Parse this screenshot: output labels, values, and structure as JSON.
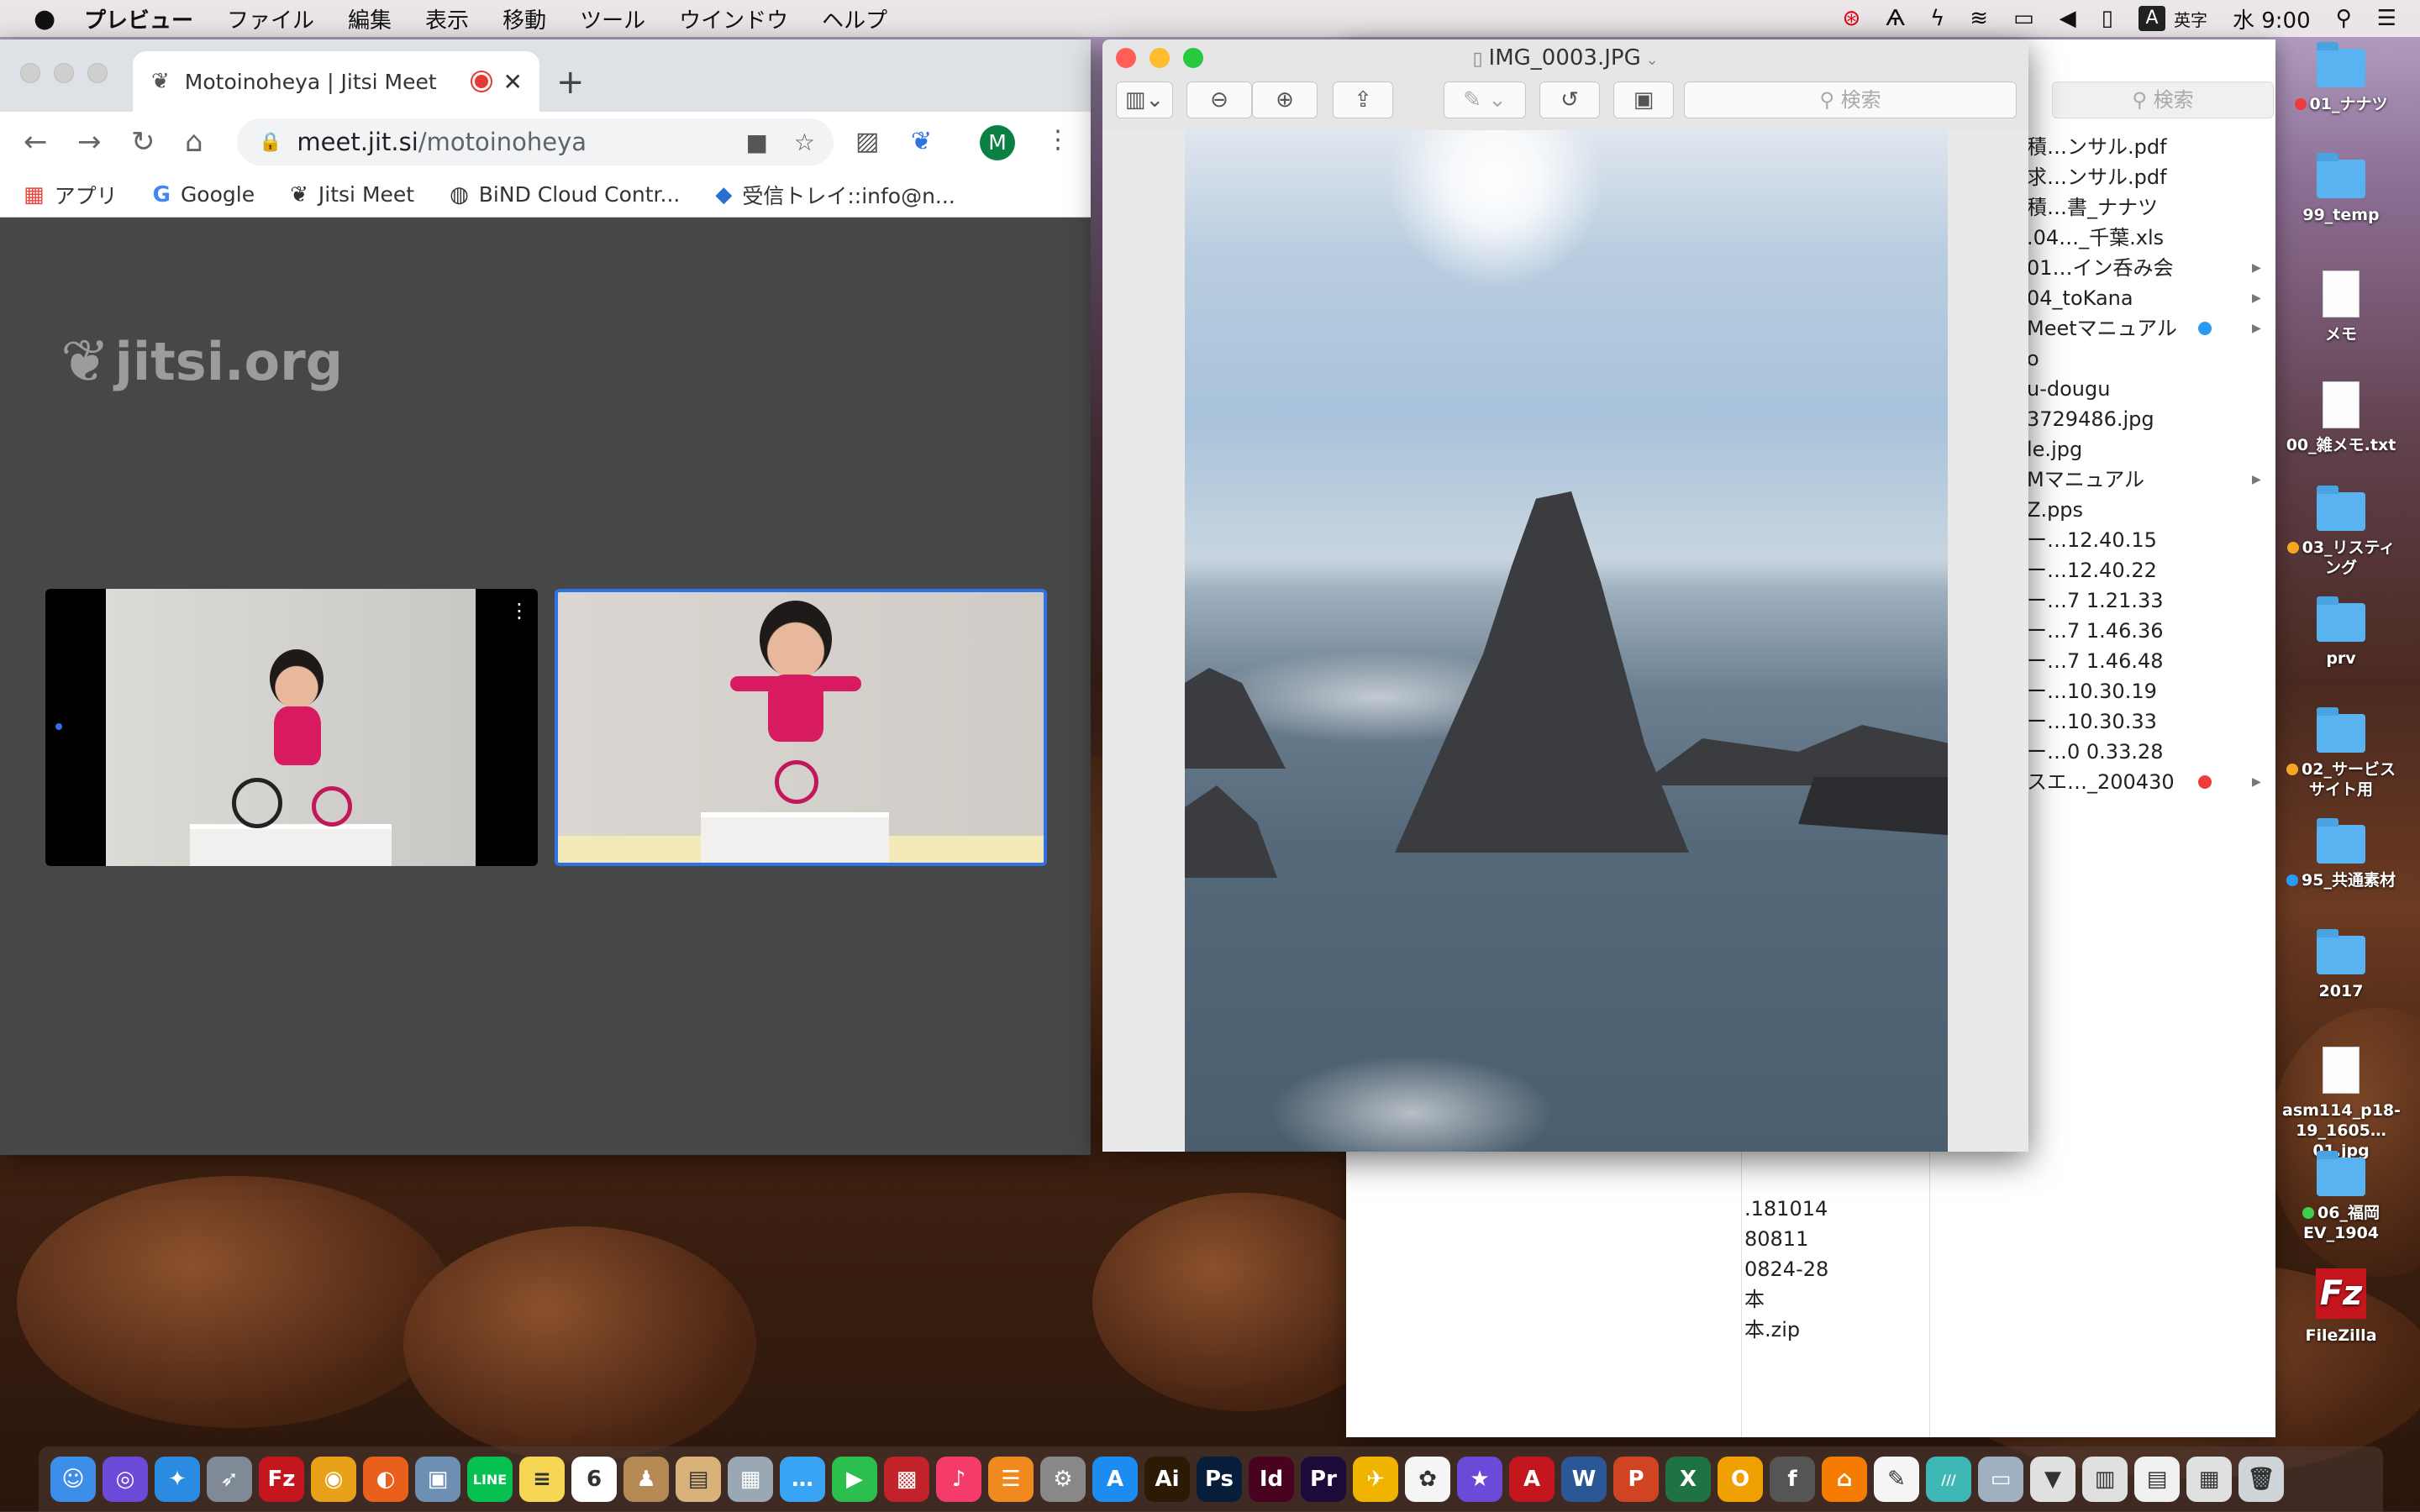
{
  "menubar": {
    "app": "プレビュー",
    "items": [
      "ファイル",
      "編集",
      "表示",
      "移動",
      "ツール",
      "ウインドウ",
      "ヘルプ"
    ],
    "ime": "A",
    "ime_label": "英字",
    "clock": "水 9:00"
  },
  "chrome": {
    "tab_title": "Motoinoheya | Jitsi Meet",
    "tab_close": "✕",
    "new_tab": "+",
    "url_host": "meet.jit.si",
    "url_path": "/motoinoheya",
    "profile_initial": "M",
    "bookmarks": [
      "アプリ",
      "Google",
      "Jitsi Meet",
      "BiND Cloud Contr...",
      "受信トレイ::info@n..."
    ],
    "bookmarks_more": "»",
    "jitsi_logo": "jitsi.org"
  },
  "preview": {
    "title": "IMG_0003.JPG",
    "search_placeholder": "検索"
  },
  "finder": {
    "search_placeholder": "検索",
    "col_a": [
      {
        "name": "積…ンサル.pdf",
        "arrow": false
      },
      {
        "name": "求…ンサル.pdf",
        "arrow": false
      },
      {
        "name": "積…書_ナナツ",
        "arrow": false
      },
      {
        "name": ".04…_千葉.xls",
        "arrow": false
      },
      {
        "name": "01…イン呑み会",
        "arrow": true
      },
      {
        "name": "04_toKana",
        "arrow": true
      },
      {
        "name": "Meetマニュアル",
        "arrow": true,
        "tag": "#2b9af3"
      },
      {
        "name": "o",
        "arrow": false
      },
      {
        "name": "u-dougu",
        "arrow": false
      },
      {
        "name": "3729486.jpg",
        "arrow": false
      },
      {
        "name": "le.jpg",
        "arrow": false
      },
      {
        "name": "Mマニュアル",
        "arrow": true
      },
      {
        "name": "Z.pps",
        "arrow": false
      },
      {
        "name": "ー…12.40.15",
        "arrow": false
      },
      {
        "name": "ー…12.40.22",
        "arrow": false
      },
      {
        "name": "ー…7 1.21.33",
        "arrow": false
      },
      {
        "name": "ー…7 1.46.36",
        "arrow": false
      },
      {
        "name": "ー…7 1.46.48",
        "arrow": false
      },
      {
        "name": "ー…10.30.19",
        "arrow": false
      },
      {
        "name": "ー…10.30.33",
        "arrow": false
      },
      {
        "name": "ー…0 0.33.28",
        "arrow": false
      },
      {
        "name": "スエ…_200430",
        "arrow": true,
        "tag": "#ee3b3b"
      }
    ],
    "col_b": [
      ".181014",
      "80811",
      "0824-28",
      "本",
      "本.zip"
    ]
  },
  "desktop": [
    {
      "label": "01_ナナツ",
      "kind": "folder",
      "dot": "#ee3b3b"
    },
    {
      "label": "99_temp",
      "kind": "folder"
    },
    {
      "label": "メモ",
      "kind": "doc"
    },
    {
      "label": "00_雑メモ.txt",
      "kind": "doc"
    },
    {
      "label": "03_リスティング",
      "kind": "folder",
      "dot": "#f5a623"
    },
    {
      "label": "prv",
      "kind": "folder"
    },
    {
      "label": "02_サービスサイト用",
      "kind": "folder",
      "dot": "#f5a623"
    },
    {
      "label": "95_共通素材",
      "kind": "folder",
      "dot": "#2b9af3"
    },
    {
      "label": "2017",
      "kind": "folder"
    },
    {
      "label": "asm114_p18-19_1605…01.jpg",
      "kind": "doc"
    },
    {
      "label": "06_福岡EV_1904",
      "kind": "folder",
      "dot": "#3ecf4e"
    },
    {
      "label": "FileZilla",
      "kind": "app"
    }
  ],
  "dock": {
    "apps": [
      {
        "name": "finder",
        "color": "#3d8ee8",
        "glyph": "☺"
      },
      {
        "name": "siri",
        "color": "#6a4ad6",
        "glyph": "◎"
      },
      {
        "name": "safari",
        "color": "#2a8be0",
        "glyph": "✦"
      },
      {
        "name": "launchpad",
        "color": "#7f8a96",
        "glyph": "➶"
      },
      {
        "name": "filezilla",
        "color": "#c4161c",
        "glyph": "Fz"
      },
      {
        "name": "chrome",
        "color": "#e8a21a",
        "glyph": "◉"
      },
      {
        "name": "firefox",
        "color": "#e8601c",
        "glyph": "◐"
      },
      {
        "name": "preview",
        "color": "#6d8fb4",
        "glyph": "▣"
      },
      {
        "name": "line",
        "color": "#06c152",
        "glyph": "LINE"
      },
      {
        "name": "notes",
        "color": "#f6d655",
        "glyph": "≡"
      },
      {
        "name": "calendar",
        "color": "#ffffff",
        "glyph": "6"
      },
      {
        "name": "contacts",
        "color": "#b58a55",
        "glyph": "♟"
      },
      {
        "name": "archive",
        "color": "#d8b27a",
        "glyph": "▤"
      },
      {
        "name": "preview2",
        "color": "#9aa8b6",
        "glyph": "▦"
      },
      {
        "name": "messages",
        "color": "#3aa4f4",
        "glyph": "…"
      },
      {
        "name": "facetime",
        "color": "#2bbf4e",
        "glyph": "▶"
      },
      {
        "name": "photobooth",
        "color": "#c2232b",
        "glyph": "▩"
      },
      {
        "name": "music",
        "color": "#f43b6a",
        "glyph": "♪"
      },
      {
        "name": "books",
        "color": "#f08a1f",
        "glyph": "☰"
      },
      {
        "name": "system-preferences",
        "color": "#888888",
        "glyph": "⚙"
      },
      {
        "name": "app-store",
        "color": "#1d8cf0",
        "glyph": "A"
      },
      {
        "name": "illustrator",
        "color": "#2c1a04",
        "glyph": "Ai"
      },
      {
        "name": "photoshop",
        "color": "#061e3a",
        "glyph": "Ps"
      },
      {
        "name": "indesign",
        "color": "#49021f",
        "glyph": "Id"
      },
      {
        "name": "premiere",
        "color": "#1c0a3a",
        "glyph": "Pr"
      },
      {
        "name": "transmit",
        "color": "#f0b400",
        "glyph": "✈"
      },
      {
        "name": "photos",
        "color": "#f5f5f5",
        "glyph": "✿"
      },
      {
        "name": "imovie",
        "color": "#6a4ad6",
        "glyph": "★"
      },
      {
        "name": "acrobat",
        "color": "#c4161c",
        "glyph": "A"
      },
      {
        "name": "word",
        "color": "#2b5797",
        "glyph": "W"
      },
      {
        "name": "powerpoint",
        "color": "#d04423",
        "glyph": "P"
      },
      {
        "name": "excel",
        "color": "#1f7244",
        "glyph": "X"
      },
      {
        "name": "outlook",
        "color": "#f0a000",
        "glyph": "O"
      },
      {
        "name": "font-book",
        "color": "#555555",
        "glyph": "f"
      },
      {
        "name": "home",
        "color": "#f57c00",
        "glyph": "⌂"
      },
      {
        "name": "textedit",
        "color": "#f5f5f5",
        "glyph": "✎"
      },
      {
        "name": "sublime",
        "color": "#3fb7b4",
        "glyph": "///"
      },
      {
        "name": "migration",
        "color": "#a0b0c0",
        "glyph": "▭"
      },
      {
        "name": "downloads",
        "color": "#e0e0e0",
        "glyph": "▼"
      },
      {
        "name": "applications",
        "color": "#e0e0e0",
        "glyph": "▥"
      },
      {
        "name": "documents",
        "color": "#f0f0f0",
        "glyph": "▤"
      },
      {
        "name": "stack",
        "color": "#e0e0e0",
        "glyph": "▦"
      },
      {
        "name": "trash",
        "color": "#cfd4d8",
        "glyph": "🗑"
      }
    ]
  }
}
